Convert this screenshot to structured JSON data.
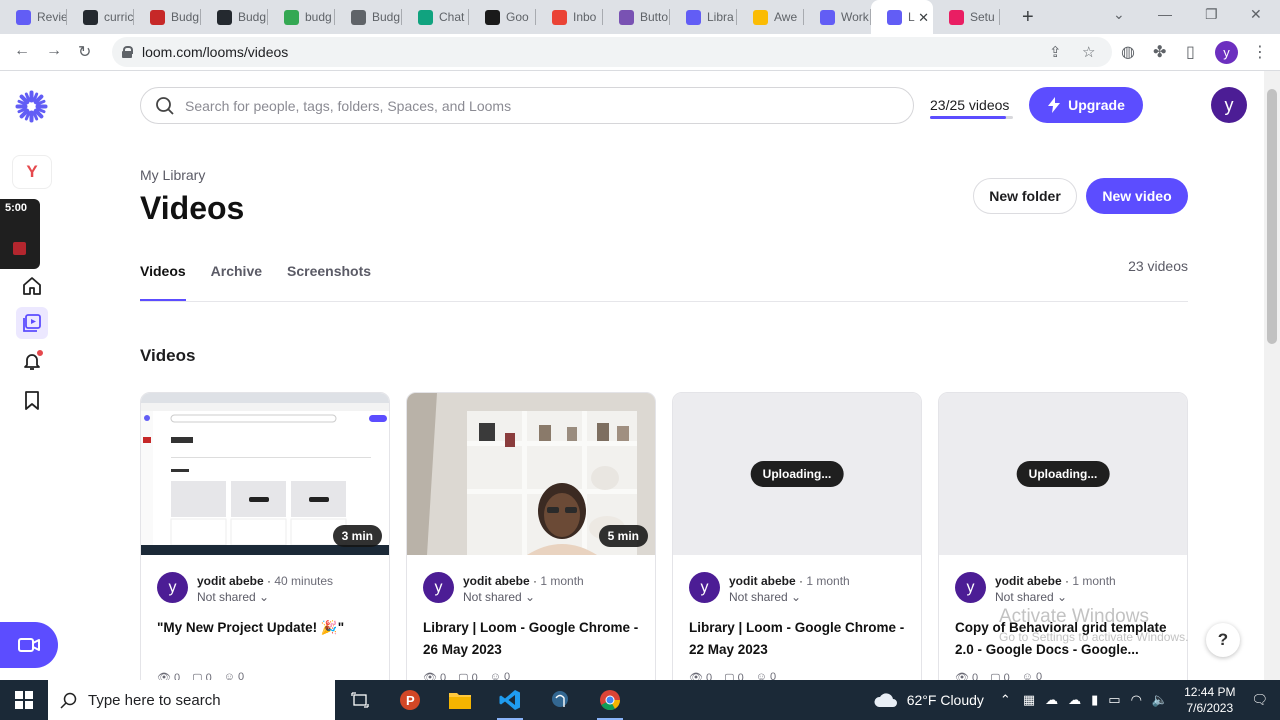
{
  "browser": {
    "tabs": [
      {
        "label": "Revie",
        "icon": "loom-icon",
        "color": "#625df5"
      },
      {
        "label": "curric",
        "icon": "github-icon",
        "color": "#24292f"
      },
      {
        "label": "Budg",
        "icon": "budget-icon",
        "color": "#c62828"
      },
      {
        "label": "Budg",
        "icon": "github-icon",
        "color": "#24292f"
      },
      {
        "label": "budg",
        "icon": "sheet-icon",
        "color": "#34a853"
      },
      {
        "label": "Budg",
        "icon": "globe-icon",
        "color": "#5f6368"
      },
      {
        "label": "Chat",
        "icon": "chatgpt-icon",
        "color": "#10a37f"
      },
      {
        "label": "Goo",
        "icon": "document-icon",
        "color": "#1a1a1a"
      },
      {
        "label": "Inbo",
        "icon": "gmail-icon",
        "color": "#ea4335"
      },
      {
        "label": "Butto",
        "icon": "bootstrap-icon",
        "color": "#7952b3"
      },
      {
        "label": "Libra",
        "icon": "loom-icon",
        "color": "#625df5"
      },
      {
        "label": "Awe",
        "icon": "drive-icon",
        "color": "#fbbc04"
      },
      {
        "label": "Work",
        "icon": "loom-icon",
        "color": "#625df5"
      },
      {
        "label": "L",
        "icon": "loom-icon",
        "color": "#625df5",
        "active": true
      },
      {
        "label": "Setu",
        "icon": "setup-icon",
        "color": "#e91e63"
      }
    ],
    "url": "loom.com/looms/videos",
    "profile_initial": "y"
  },
  "sidebar": {
    "workspace_initial": "Y",
    "recording_time": "5:00"
  },
  "header": {
    "search_placeholder": "Search for people, tags, folders, Spaces, and Looms",
    "quota_text": "23/25 videos",
    "quota_fraction": 0.92,
    "upgrade_label": "Upgrade",
    "user_initial": "y"
  },
  "library": {
    "breadcrumb": "My Library",
    "title": "Videos",
    "new_folder_label": "New folder",
    "new_video_label": "New video",
    "tabs": [
      "Videos",
      "Archive",
      "Screenshots"
    ],
    "video_count": "23 videos",
    "section_title": "Videos"
  },
  "videos": [
    {
      "owner": "yodit abebe",
      "time": "40 minutes",
      "sharing": "Not shared",
      "title": "\"My New Project Update! 🎉\"",
      "duration": "3 min",
      "status": "",
      "views": "0",
      "comments": "0",
      "reactions": "0"
    },
    {
      "owner": "yodit abebe",
      "time": "1 month",
      "sharing": "Not shared",
      "title": "Library | Loom - Google Chrome - 26 May 2023",
      "duration": "5 min",
      "status": "",
      "views": "0",
      "comments": "0",
      "reactions": "0"
    },
    {
      "owner": "yodit abebe",
      "time": "1 month",
      "sharing": "Not shared",
      "title": "Library | Loom - Google Chrome - 22 May 2023",
      "duration": "",
      "status": "Uploading...",
      "views": "0",
      "comments": "0",
      "reactions": "0"
    },
    {
      "owner": "yodit abebe",
      "time": "1 month",
      "sharing": "Not shared",
      "title": "Copy of Behavioral grid template 2.0 - Google Docs - Google...",
      "duration": "",
      "status": "Uploading...",
      "views": "0",
      "comments": "0",
      "reactions": "0"
    }
  ],
  "card_avatar_initial": "y",
  "watermark": {
    "line1": "Activate Windows",
    "line2": "Go to Settings to activate Windows."
  },
  "help_label": "?",
  "taskbar": {
    "search_placeholder": "Type here to search",
    "weather": "62°F  Cloudy",
    "time": "12:44 PM",
    "date": "7/6/2023"
  },
  "colors": {
    "accent": "#5c4dff",
    "avatar": "#4c1d95"
  }
}
